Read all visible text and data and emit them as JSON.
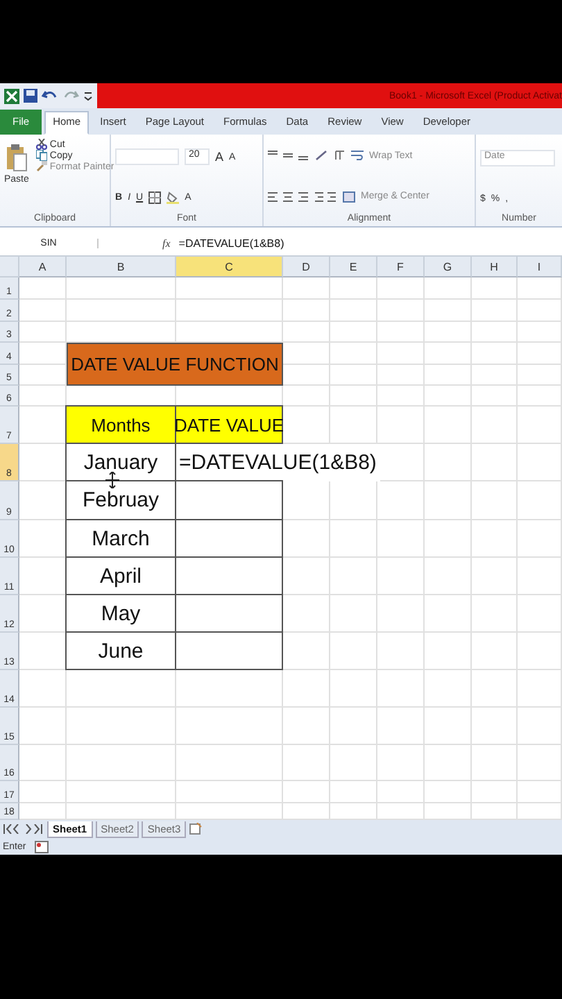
{
  "title_bar": {
    "title": "Book1 - Microsoft Excel (Product Activat"
  },
  "ribbon_tabs": [
    {
      "label": "File",
      "kind": "file",
      "selected": false
    },
    {
      "label": "Home",
      "kind": "tab",
      "selected": true
    },
    {
      "label": "Insert",
      "kind": "tab",
      "selected": false
    },
    {
      "label": "Page Layout",
      "kind": "tab",
      "selected": false
    },
    {
      "label": "Formulas",
      "kind": "tab",
      "selected": false
    },
    {
      "label": "Data",
      "kind": "tab",
      "selected": false
    },
    {
      "label": "Review",
      "kind": "tab",
      "selected": false
    },
    {
      "label": "View",
      "kind": "tab",
      "selected": false
    },
    {
      "label": "Developer",
      "kind": "tab",
      "selected": false
    }
  ],
  "clipboard": {
    "paste": "Paste",
    "cut": "Cut",
    "copy": "Copy",
    "format_painter": "Format Painter",
    "label": "Clipboard"
  },
  "font": {
    "size": "20",
    "grow": "A",
    "shrink": "A",
    "bold": "B",
    "italic": "I",
    "underline": "U",
    "color_letter": "A",
    "label": "Font"
  },
  "alignment": {
    "wrap_text": "Wrap Text",
    "merge_center": "Merge & Center",
    "label": "Alignment"
  },
  "number": {
    "format": "Date",
    "currency": "$",
    "percent": "%",
    "comma": ",",
    "label": "Number"
  },
  "formula_bar": {
    "name_box": "SIN",
    "function_label": "fx",
    "formula": "=DATEVALUE(1&B8)"
  },
  "columns": [
    {
      "label": "A",
      "selected": false
    },
    {
      "label": "B",
      "selected": false
    },
    {
      "label": "C",
      "selected": true
    },
    {
      "label": "D",
      "selected": false
    },
    {
      "label": "E",
      "selected": false
    },
    {
      "label": "F",
      "selected": false
    },
    {
      "label": "G",
      "selected": false
    },
    {
      "label": "H",
      "selected": false
    },
    {
      "label": "I",
      "selected": false
    }
  ],
  "rows": [
    {
      "label": "1",
      "selected": false
    },
    {
      "label": "2",
      "selected": false
    },
    {
      "label": "3",
      "selected": false
    },
    {
      "label": "4",
      "selected": false
    },
    {
      "label": "5",
      "selected": false
    },
    {
      "label": "6",
      "selected": false
    },
    {
      "label": "7",
      "selected": false
    },
    {
      "label": "8",
      "selected": true
    },
    {
      "label": "9",
      "selected": false
    },
    {
      "label": "10",
      "selected": false
    },
    {
      "label": "11",
      "selected": false
    },
    {
      "label": "12",
      "selected": false
    },
    {
      "label": "13",
      "selected": false
    },
    {
      "label": "14",
      "selected": false
    },
    {
      "label": "15",
      "selected": false
    },
    {
      "label": "16",
      "selected": false
    },
    {
      "label": "17",
      "selected": false
    },
    {
      "label": "18",
      "selected": false
    }
  ],
  "title_cell": "DATE VALUE FUNCTION",
  "table": {
    "headers": [
      "Months",
      "DATE VALUE"
    ],
    "rows": [
      {
        "month": "January",
        "value": "=DATEVALUE(1&B8)"
      },
      {
        "month": "Februay"
      },
      {
        "month": "March"
      },
      {
        "month": "April"
      },
      {
        "month": "May"
      },
      {
        "month": "June"
      }
    ]
  },
  "sheet_tabs": [
    {
      "label": "Sheet1",
      "selected": true
    },
    {
      "label": "Sheet2",
      "selected": false
    },
    {
      "label": "Sheet3",
      "selected": false
    }
  ],
  "status_bar": {
    "mode": "Enter"
  }
}
